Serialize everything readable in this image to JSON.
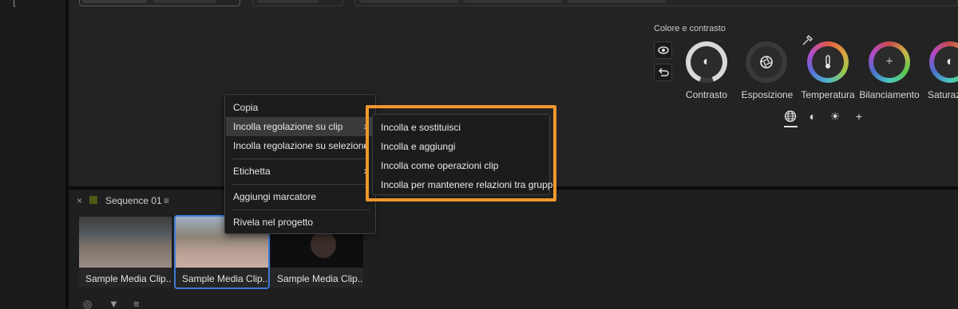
{
  "rail": {
    "mark": "["
  },
  "color_panel": {
    "title": "Colore e contrasto",
    "dials": [
      {
        "label": "Contrasto",
        "icon": "contrast-icon"
      },
      {
        "label": "Esposizione",
        "icon": "aperture-icon"
      },
      {
        "label": "Temperatura",
        "icon": "thermometer-icon"
      },
      {
        "label": "Bilanciamento",
        "icon": "plus-icon"
      },
      {
        "label": "Saturazi",
        "icon": "saturation-icon"
      }
    ],
    "mode_add": "+"
  },
  "sequence": {
    "close": "×",
    "name": "Sequence 01",
    "menu": "≡",
    "clips": [
      {
        "caption": "Sample Media Clip..."
      },
      {
        "caption": "Sample Media Clip..."
      },
      {
        "caption": "Sample Media Clip..."
      }
    ]
  },
  "context_menu": {
    "items": [
      {
        "label": "Copia"
      },
      {
        "label": "Incolla regolazione su clip",
        "submenu": true,
        "highlighted": true
      },
      {
        "label": "Incolla regolazione su selezione",
        "submenu": true
      },
      {
        "label": "Etichetta",
        "submenu": true
      },
      {
        "label": "Aggiungi marcatore"
      },
      {
        "label": "Rivela nel progetto"
      }
    ],
    "arrow": "›"
  },
  "submenu": {
    "items": [
      "Incolla e sostituisci",
      "Incolla e aggiungi",
      "Incolla come operazioni clip",
      "Incolla per mantenere relazioni tra gruppi"
    ]
  },
  "colors": {
    "highlight": "#f0962c",
    "selection": "#3d7bd9"
  }
}
